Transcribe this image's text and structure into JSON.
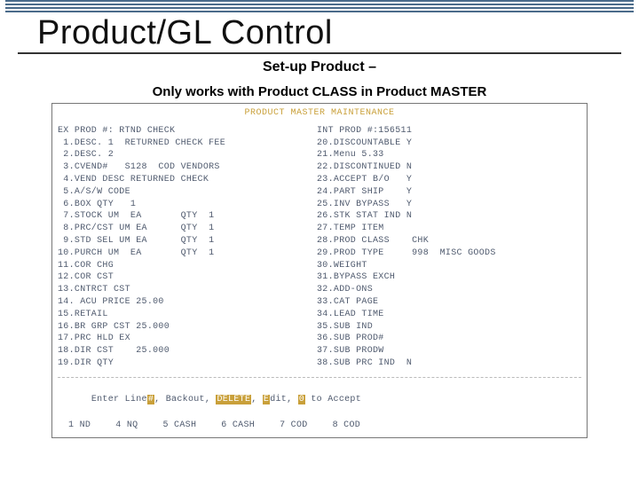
{
  "title": "Product/GL Control",
  "subtitle1": "Set-up Product –",
  "subtitle2": "Only works with Product CLASS in Product MASTER",
  "terminal": {
    "header": "PRODUCT MASTER MAINTENANCE",
    "left": {
      "r0": "EX PROD #: RTND CHECK",
      "r1": " 1.DESC. 1  RETURNED CHECK FEE",
      "r2": " 2.DESC. 2",
      "r3": " 3.CVEND#   S128  COD VENDORS",
      "r4": " 4.VEND DESC RETURNED CHECK",
      "r5": " 5.A/S/W CODE",
      "r6": " 6.BOX QTY   1",
      "r7": " 7.STOCK UM  EA       QTY  1",
      "r8": " 8.PRC/CST UM EA      QTY  1",
      "r9": " 9.STD SEL UM EA      QTY  1",
      "r10": "10.PURCH UM  EA       QTY  1",
      "r11": "11.COR CHG",
      "r12": "12.COR CST",
      "r13": "13.CNTRCT CST",
      "r14": "14. ACU PRICE 25.00",
      "r15": "15.RETAIL",
      "r16": "16.BR GRP CST 25.000",
      "r17": "17.PRC HLD EX",
      "r18": "18.DIR CST    25.000",
      "r19": "19.DIR QTY"
    },
    "right": {
      "r0": "INT PROD #:156511",
      "r1": "20.DISCOUNTABLE Y",
      "r2": "21.Menu 5.33",
      "r3": "22.DISCONTINUED N",
      "r4": "23.ACCEPT B/O   Y",
      "r5": "24.PART SHIP    Y",
      "r6": "25.INV BYPASS   Y",
      "r7": "26.STK STAT IND N",
      "r8": "27.TEMP ITEM",
      "r9": "28.PROD CLASS    CHK",
      "r10": "29.PROD TYPE     998  MISC GOODS",
      "r11": "30.WEIGHT",
      "r12": "31.BYPASS EXCH",
      "r13": "32.ADD-ONS",
      "r14": "33.CAT PAGE",
      "r15": "34.LEAD TIME",
      "r16": "35.SUB IND",
      "r17": "36.SUB PROD#",
      "r18": "37.SUB PRODW",
      "r19": "38.SUB PRC IND  N"
    },
    "footer": {
      "prompt_pre": "Enter Line",
      "prompt_hl1": "#",
      "prompt_mid": ", Backout, ",
      "prompt_hl2": "DELETE",
      "prompt_mid2": ", ",
      "prompt_hl3": "E",
      "prompt_mid3": "dit, ",
      "prompt_hl4": "0",
      "prompt_end": " to Accept",
      "opts": {
        "o1": "1 ND",
        "o4": "4 NQ",
        "o5": "5 CASH",
        "o6": "6 CASH",
        "o7": "7 COD",
        "o8": "8 COD"
      }
    }
  }
}
